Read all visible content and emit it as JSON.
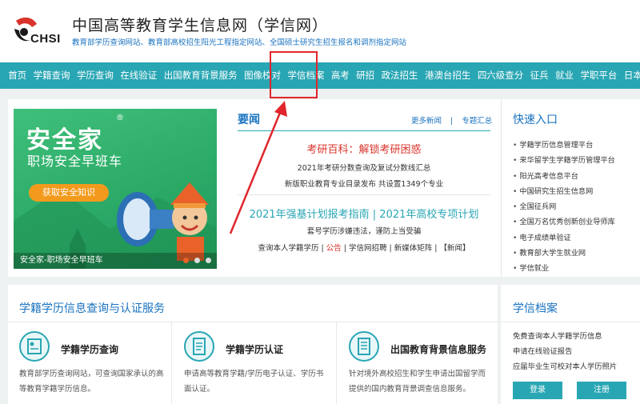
{
  "header": {
    "logo_text": "CHSI",
    "title": "中国高等教育学生信息网（学信网）",
    "subtitle": "教育部学历查询网站、教育部高校招生阳光工程指定网站、全国硕士研究生招生报名和调剂指定网站"
  },
  "nav": {
    "items": [
      "首页",
      "学籍查询",
      "学历查询",
      "在线验证",
      "出国教育背景服务",
      "图像校对",
      "学信档案",
      "高考",
      "研招",
      "政法招生",
      "港澳台招生",
      "四六级查分",
      "征兵",
      "就业",
      "学职平台",
      "日本频道"
    ]
  },
  "banner": {
    "title": "安全家",
    "reg_mark": "®",
    "subtitle": "职场安全早班车",
    "button": "获取安全知识",
    "caption": "安全家-职场安全早班车"
  },
  "news": {
    "title": "要闻",
    "more_link": "更多新闻",
    "separator": "|",
    "topics_link": "专题汇总",
    "headline1": "考研百科：解锁考研困惑",
    "item1": "2021年考研分数查询及复试分数线汇总",
    "item2": "新版职业教育专业目录发布 共设置1349个专业",
    "headline2": "2021年强基计划报考指南 | 2021年高校专项计划",
    "item3": "套号学历涉嫌违法，谨防上当受骗",
    "item4_a": "查询本人学籍学历",
    "item4_sep1": " | ",
    "item4_b": "公告",
    "item4_c": " | 学信网招聘 | 新媒体矩阵 | 【新闻】"
  },
  "quick": {
    "title": "快速入口",
    "items": [
      "学籍学历信息管理平台",
      "来华留学生学籍学历管理平台",
      "阳光高考信息平台",
      "中国研究生招生信息网",
      "全国征兵网",
      "全国万名优秀创新创业导师库",
      "电子成绩单验证",
      "教育部大学生就业网",
      "学信就业"
    ]
  },
  "services": {
    "title": "学籍学历信息查询与认证服务",
    "items": [
      {
        "name": "学籍学历查询",
        "desc": "教育部学历查询网站，可查询国家承认的高等教育学籍学历信息。"
      },
      {
        "name": "学籍学历认证",
        "desc": "申请高等教育学籍/学历电子认证、学历书面认证。"
      },
      {
        "name": "出国教育背景信息服务",
        "desc": "针对境外高校招生和学生申请出国留学而提供的国内教育背景调查信息服务。"
      }
    ]
  },
  "archive": {
    "title": "学信档案",
    "items": [
      "免费查询本人学籍学历信息",
      "申请在线验证报告",
      "应届毕业生可校对本人学历照片"
    ],
    "login": "登录",
    "register": "注册"
  },
  "colors": {
    "nav_bg": "#29a6b4",
    "link_blue": "#1a73c0",
    "headline_red": "#d9342b",
    "annotation_red": "#e0262c",
    "banner_green": "#2aa866",
    "banner_orange": "#f39a1c"
  }
}
